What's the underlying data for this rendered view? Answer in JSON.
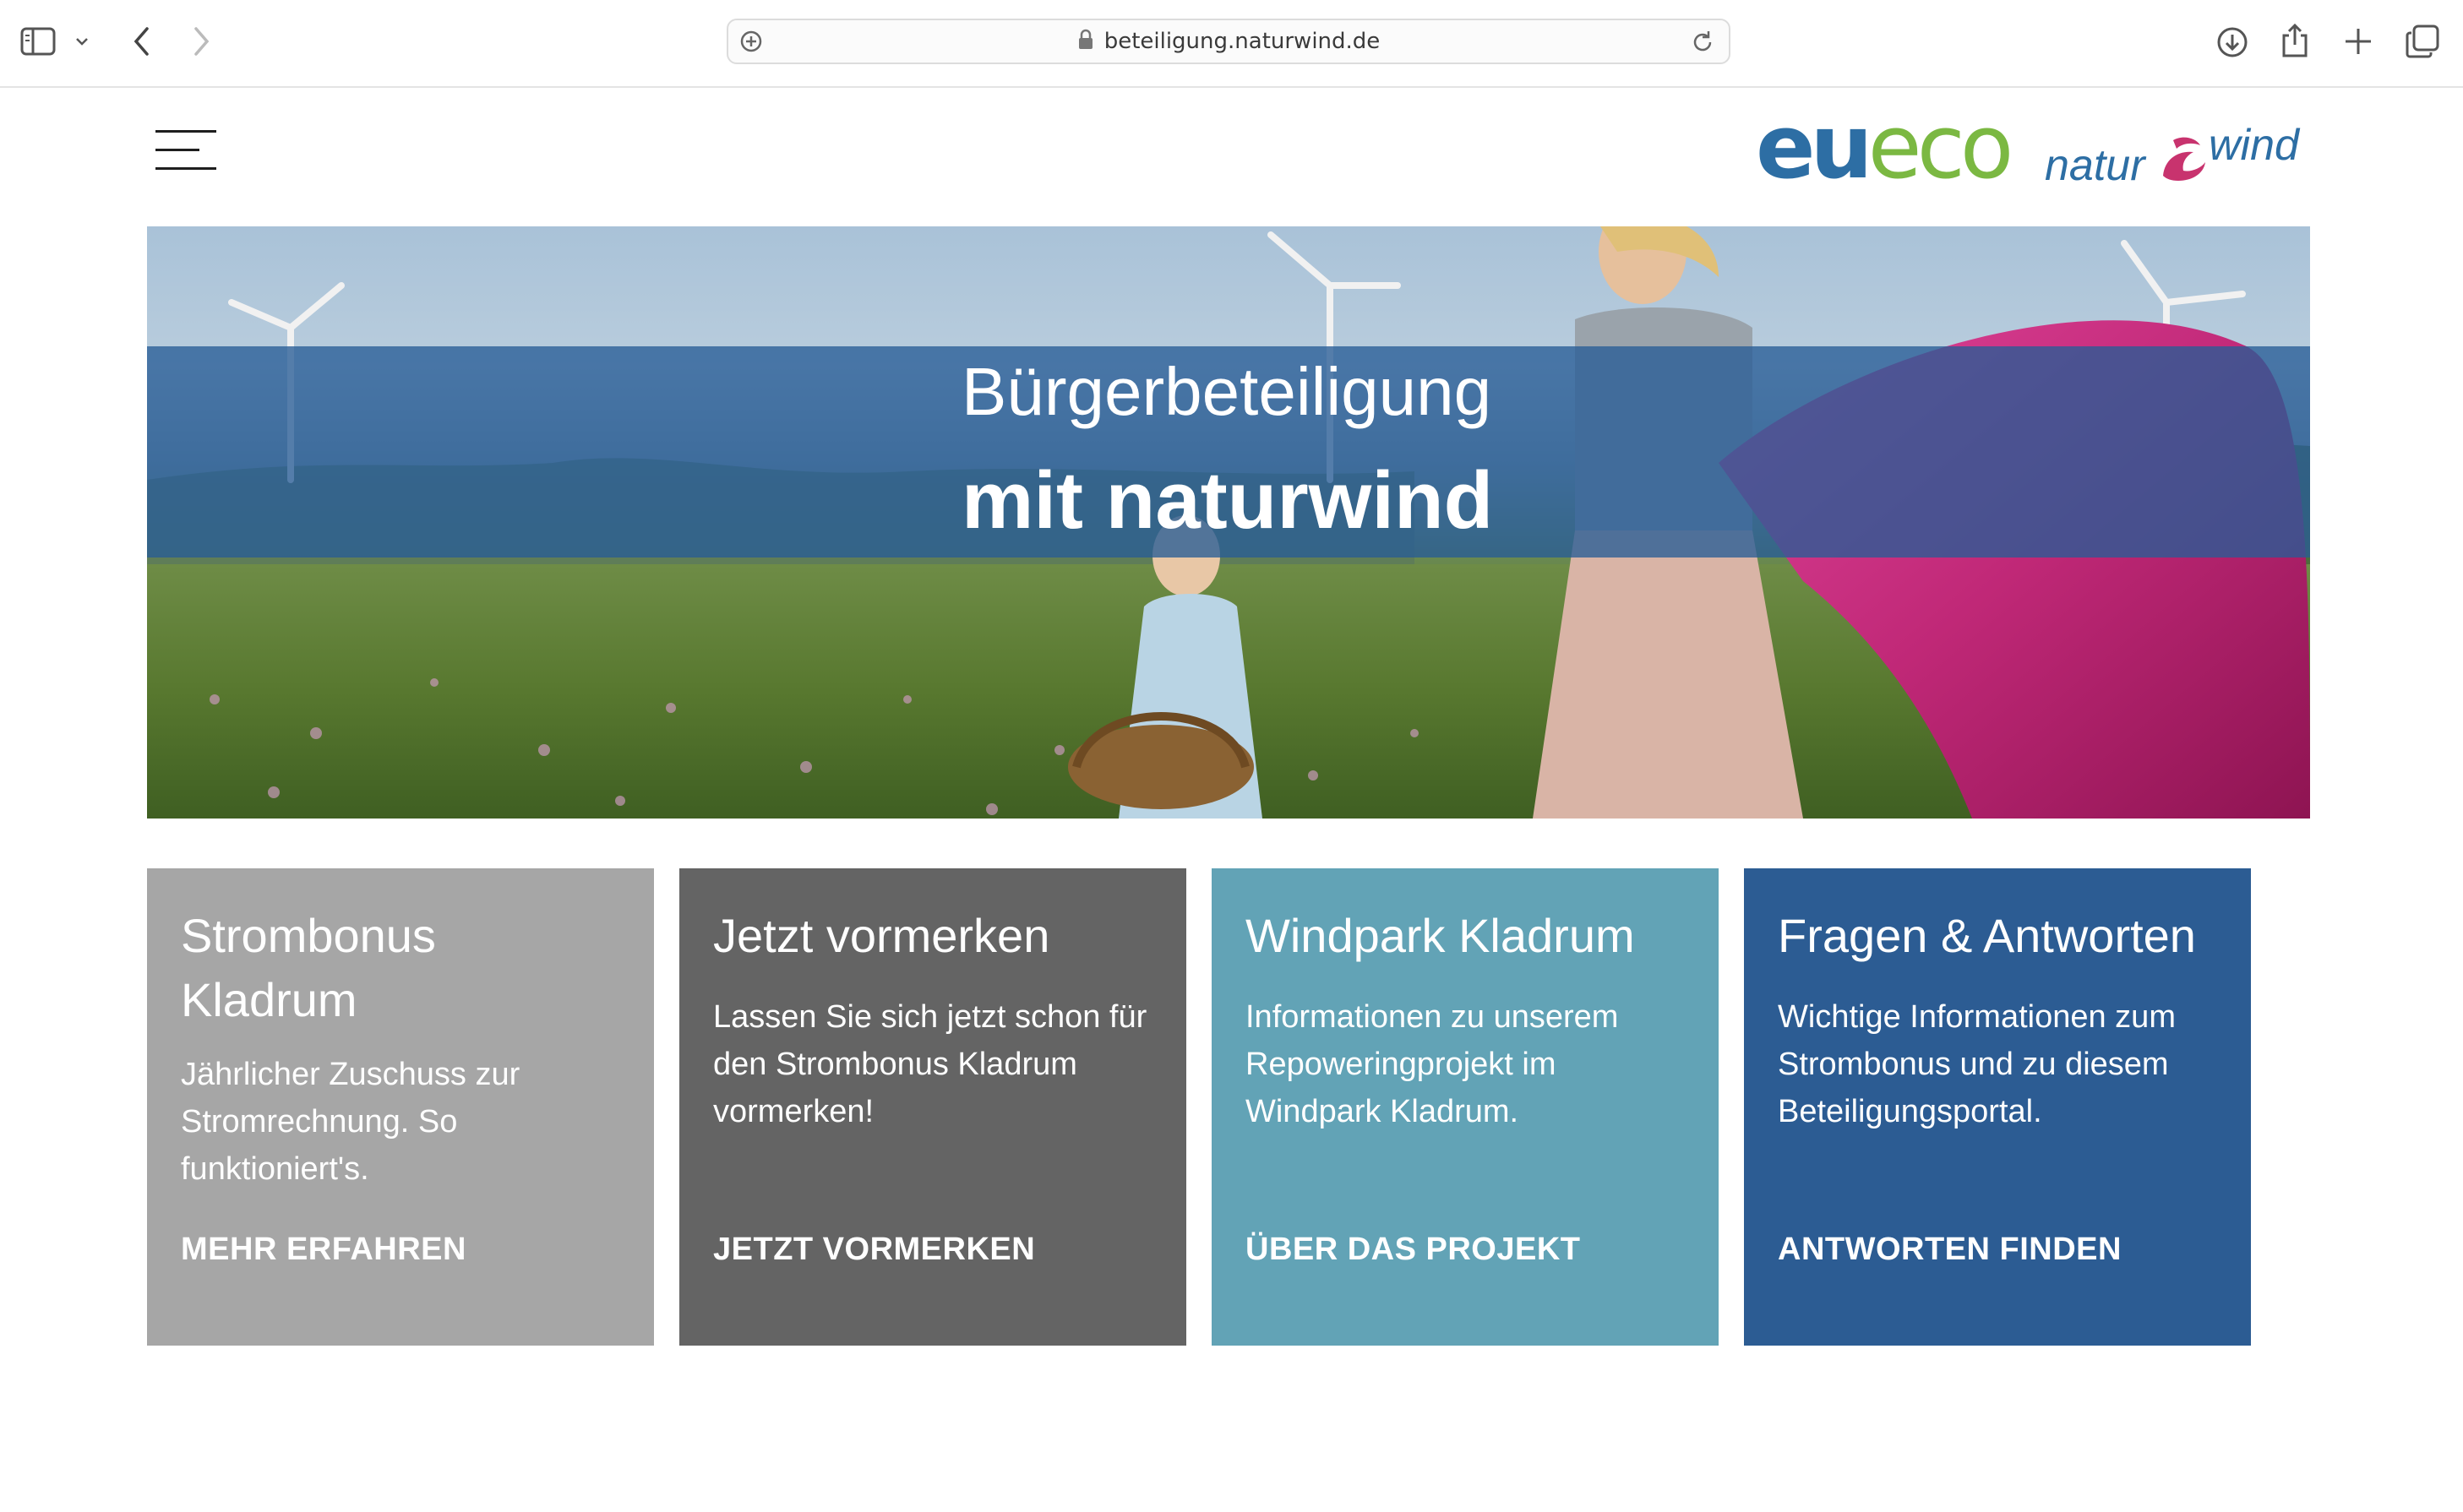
{
  "browser": {
    "url": "beteiligung.naturwind.de"
  },
  "header": {
    "logo_eueco_part1": "eu",
    "logo_eueco_part2": "eco",
    "logo_naturwind_part1": "natur",
    "logo_naturwind_part2": "wind"
  },
  "hero": {
    "line1": "Bürgerbeteiligung",
    "line2": "mit naturwind"
  },
  "cards": [
    {
      "title": "Strombonus Kladrum",
      "body": "Jährlicher Zuschuss zur Stromrechnung. So funktioniert's.",
      "link": "MEHR ERFAHREN",
      "color": "#a6a6a6"
    },
    {
      "title": "Jetzt vormerken",
      "body": "Lassen Sie sich jetzt schon für den Strombonus Kladrum vormerken!",
      "link": "JETZT VORMERKEN",
      "color": "#646464"
    },
    {
      "title": "Windpark Kladrum",
      "body": "Informationen zu unserem Repoweringprojekt im Windpark Kladrum.",
      "link": "ÜBER DAS PROJEKT",
      "color": "#62a3b6"
    },
    {
      "title": "Fragen & Antworten",
      "body": "Wichtige Informationen zum Strombonus und zu diesem Beteiligungsportal.",
      "link": "ANTWORTEN FINDEN",
      "color": "#2c5c93"
    }
  ],
  "colors": {
    "brand_blue": "#2d6ea4",
    "brand_green": "#7bb842",
    "brand_magenta": "#c8336e",
    "hero_band": "#285c96"
  },
  "icons": {
    "sidebar": "sidebar-icon",
    "tab_overview_chevron": "chevron-down-icon",
    "back": "back-arrow-icon",
    "forward": "forward-arrow-icon",
    "site_settings": "site-settings-icon",
    "lock": "lock-icon",
    "reload": "reload-icon",
    "downloads": "download-icon",
    "share": "share-icon",
    "new_tab": "plus-icon",
    "tabs": "tab-overview-icon",
    "menu": "hamburger-menu-icon"
  }
}
